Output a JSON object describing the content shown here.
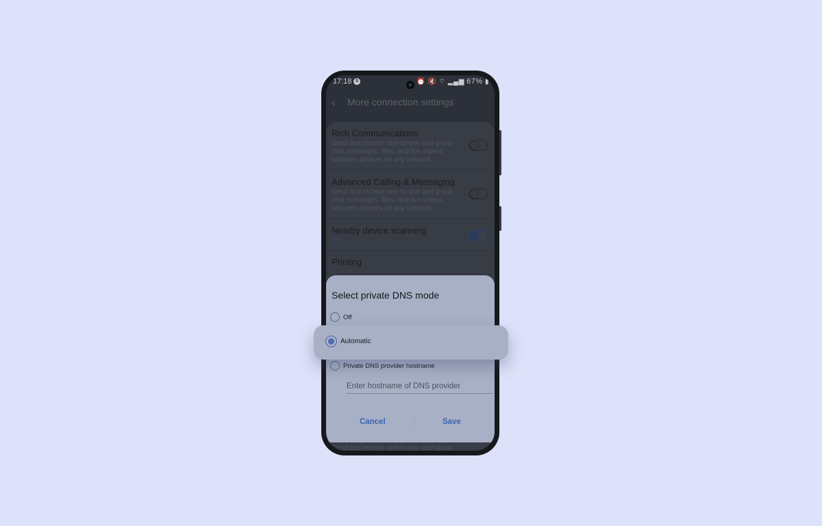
{
  "status_bar": {
    "time": "17:18",
    "notification_icon": "S",
    "icons": [
      "alarm-icon",
      "mute-icon",
      "volte-icon",
      "wifi-icon",
      "signal-icon",
      "signal-icon"
    ],
    "battery": "67%"
  },
  "app_bar": {
    "back_icon": "back-chevron-icon",
    "title": "More connection settings"
  },
  "settings": [
    {
      "title": "Rich Communications",
      "description": "Send and receive one-to-one and group chat messages, files, and live videos between devices on any network.",
      "toggle_on": false
    },
    {
      "title": "Advanced Calling & Messaging",
      "description": "Send and receive one-to-one and group chat messages, files, and live videos between devices on any network.",
      "toggle_on": false
    },
    {
      "title": "Nearby device scanning",
      "status": "On",
      "toggle_on": true
    },
    {
      "title": "Printing"
    }
  ],
  "dialog": {
    "title": "Select private DNS mode",
    "options": [
      {
        "label": "Off",
        "selected": false
      },
      {
        "label": "Automatic",
        "selected": true
      },
      {
        "label": "Private DNS provider hostname",
        "selected": false
      }
    ],
    "hostname_placeholder": "Enter hostname of DNS provider",
    "hostname_value": "",
    "cancel_label": "Cancel",
    "save_label": "Save"
  },
  "bottom_peek_text": "Send and receive one-to-one and group",
  "colors": {
    "background": "#dde1f9",
    "dialog": "#a7b0c5",
    "accent": "#3c64b8"
  }
}
